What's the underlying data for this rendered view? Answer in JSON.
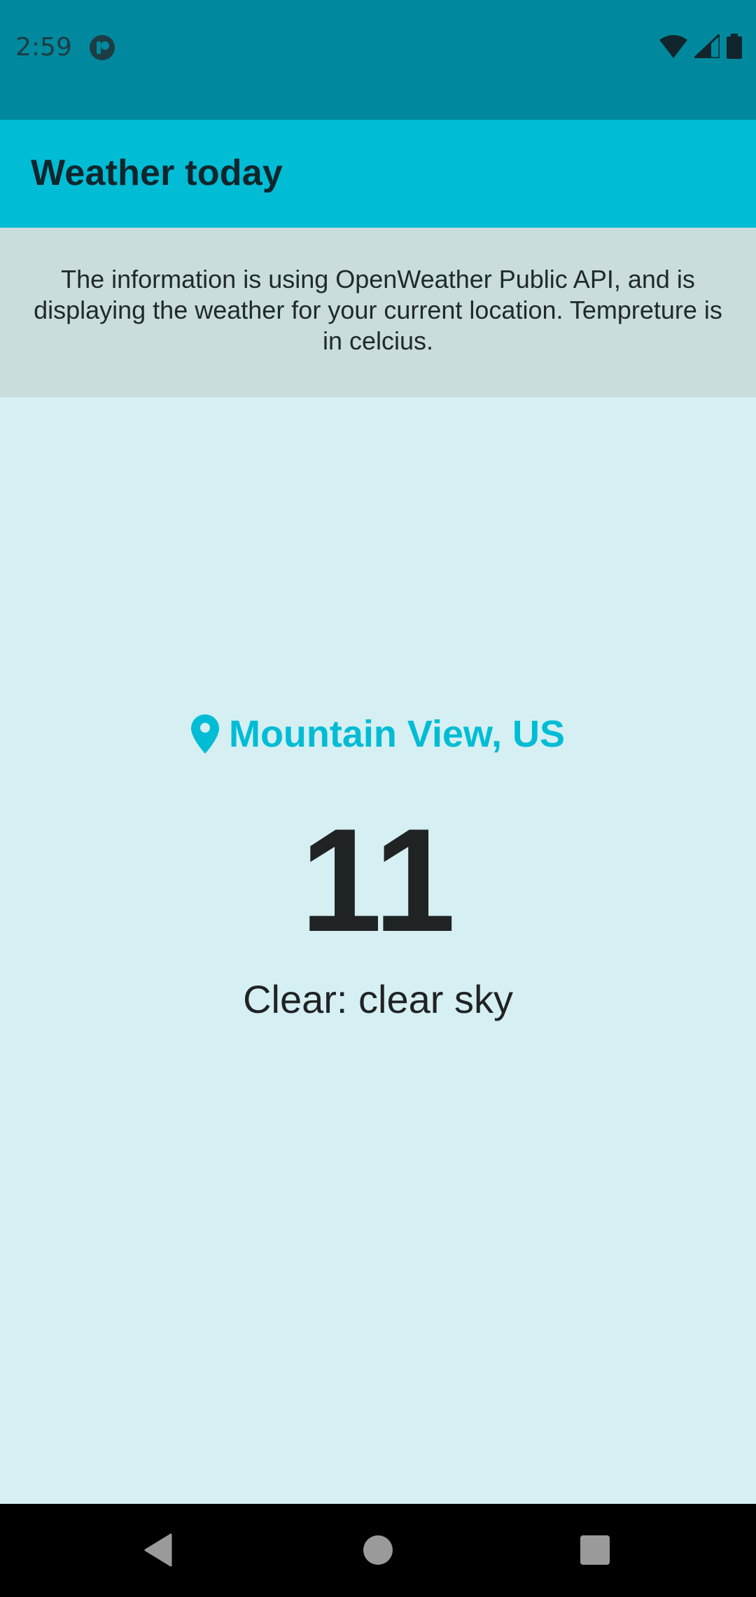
{
  "status_bar": {
    "time": "2:59",
    "app_icon": "notification-app-icon",
    "icons": [
      "wifi-icon",
      "signal-icon",
      "battery-icon"
    ],
    "background": "#00899e"
  },
  "app_bar": {
    "title": "Weather today",
    "background": "#00bcd5"
  },
  "info": {
    "text": "The information is using OpenWeather Public API, and is displaying the weather for your current location. Tempreture is in celcius.",
    "background": "#cbdcdd"
  },
  "weather": {
    "location_icon": "location-pin-icon",
    "location": "Mountain View, US",
    "temperature": "11",
    "condition": "Clear: clear sky",
    "accent": "#00bcd5"
  },
  "nav_bar": {
    "buttons": [
      "back-icon",
      "home-icon",
      "recents-icon"
    ]
  }
}
